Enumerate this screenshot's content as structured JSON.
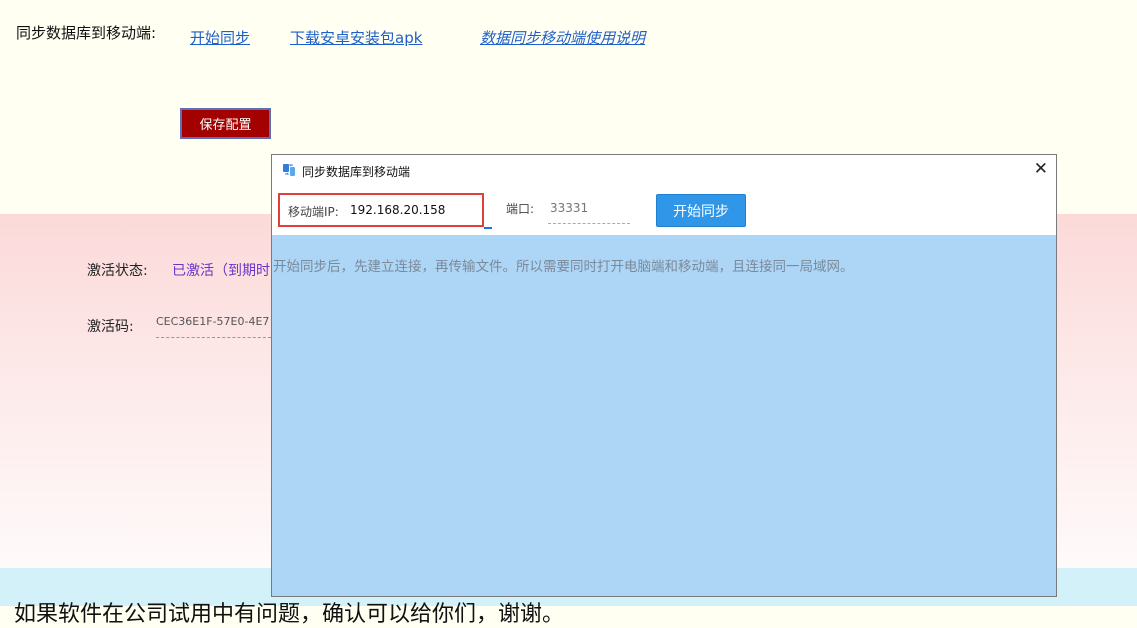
{
  "top": {
    "label": "同步数据库到移动端:",
    "links": [
      "开始同步",
      "下载安卓安装包apk",
      "数据同步移动端使用说明"
    ],
    "save_button": "保存配置"
  },
  "activation": {
    "status_label": "激活状态:",
    "status_value": "已激活（到期时",
    "code_label": "激活码:",
    "code_value": "CEC36E1F-57E0-4E7"
  },
  "bottom_text": "如果软件在公司试用中有问题，确认可以给你们，谢谢。",
  "dialog": {
    "title": "同步数据库到移动端",
    "ip_label": "移动端IP:",
    "ip_value": "192.168.20.158",
    "port_label": "端口:",
    "port_placeholder": "33331",
    "start_button": "开始同步",
    "message": "开始同步后，先建立连接，再传输文件。所以需要同时打开电脑端和移动端，且连接同一局域网。"
  },
  "colors": {
    "save_button_bg": "#a30000",
    "start_button_bg": "#2f96e8",
    "link": "#1f5fc8",
    "ip_highlight": "#e0403a"
  },
  "icons": [
    "sync-app-icon",
    "close-icon"
  ]
}
